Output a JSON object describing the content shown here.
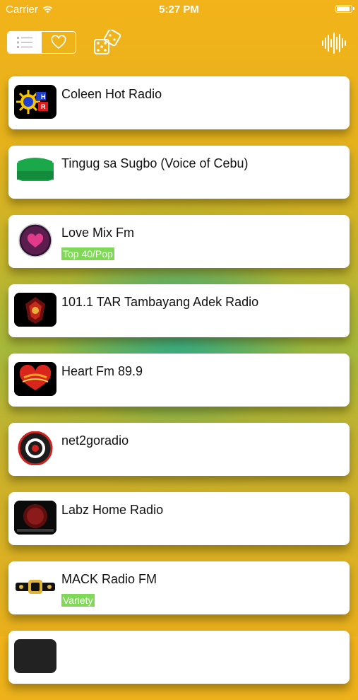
{
  "status_bar": {
    "carrier": "Carrier",
    "time": "5:27 PM",
    "battery_level": 0.9
  },
  "toolbar": {
    "segments": [
      {
        "icon": "list-icon",
        "selected": true
      },
      {
        "icon": "heart-icon",
        "selected": false
      }
    ],
    "random_icon": "dice-icon",
    "equalizer_icon": "soundwave-icon"
  },
  "stations": [
    {
      "name": "Coleen Hot Radio",
      "genre": "",
      "logo": "coleen-logo",
      "logo_bg": "#000000"
    },
    {
      "name": "Tingug sa Sugbo (Voice of Cebu)",
      "genre": "",
      "logo": "tingug-logo",
      "logo_bg": "#ffffff"
    },
    {
      "name": "Love Mix Fm",
      "genre": "Top 40/Pop",
      "logo": "lovemix-logo",
      "logo_bg": "#ffffff"
    },
    {
      "name": "101.1 TAR Tambayang Adek Radio",
      "genre": "",
      "logo": "tar-logo",
      "logo_bg": "#000000"
    },
    {
      "name": "Heart Fm 89.9",
      "genre": "",
      "logo": "heartfm-logo",
      "logo_bg": "#000000"
    },
    {
      "name": "net2goradio",
      "genre": "",
      "logo": "net2go-logo",
      "logo_bg": "#ffffff"
    },
    {
      "name": "Labz Home Radio",
      "genre": "",
      "logo": "labz-logo",
      "logo_bg": "#000000"
    },
    {
      "name": "MACK Radio FM",
      "genre": "Variety",
      "logo": "mack-logo",
      "logo_bg": "#ffffff"
    }
  ],
  "colors": {
    "genre_badge": "#7fd957",
    "accent": "#f3b31a"
  }
}
